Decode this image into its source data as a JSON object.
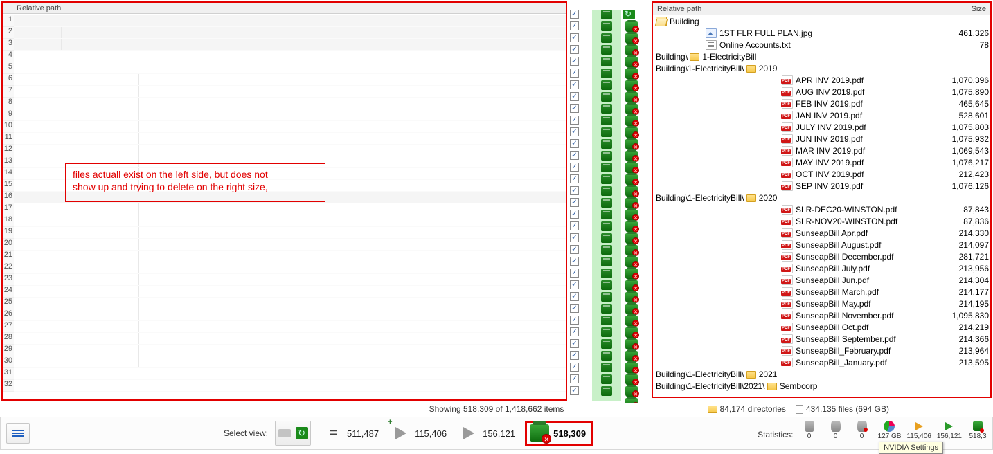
{
  "left": {
    "header": "Relative path",
    "annotation_line1": "files actuall exist on the left side, but does not",
    "annotation_line2": "show up and trying to delete on the right size,",
    "row_numbers": [
      "1",
      "2",
      "3",
      "4",
      "5",
      "6",
      "7",
      "8",
      "9",
      "10",
      "11",
      "12",
      "13",
      "14",
      "15",
      "16",
      "17",
      "18",
      "19",
      "20",
      "21",
      "22",
      "23",
      "24",
      "25",
      "26",
      "27",
      "28",
      "29",
      "30",
      "31",
      "32"
    ]
  },
  "right": {
    "header_path": "Relative path",
    "header_size": "Size",
    "rows": [
      {
        "type": "group",
        "indent": 0,
        "icon": "folder-open",
        "label": "Building",
        "size": ""
      },
      {
        "type": "file",
        "indent": 76,
        "icon": "img",
        "label": "1ST FLR FULL PLAN.jpg",
        "size": "461,326"
      },
      {
        "type": "file",
        "indent": 76,
        "icon": "txt",
        "label": "Online Accounts.txt",
        "size": "78"
      },
      {
        "type": "group-path",
        "indent": 0,
        "label": "Building\\",
        "icon": "folder-open",
        "suffix": "1-ElectricityBill",
        "size": ""
      },
      {
        "type": "group-path",
        "indent": 0,
        "label": "Building\\1-ElectricityBill\\",
        "icon": "folder-open",
        "suffix": "2019",
        "size": ""
      },
      {
        "type": "file",
        "indent": 186,
        "icon": "pdf",
        "label": "APR INV 2019.pdf",
        "size": "1,070,396"
      },
      {
        "type": "file",
        "indent": 186,
        "icon": "pdf",
        "label": "AUG INV 2019.pdf",
        "size": "1,075,890"
      },
      {
        "type": "file",
        "indent": 186,
        "icon": "pdf",
        "label": "FEB INV 2019.pdf",
        "size": "465,645"
      },
      {
        "type": "file",
        "indent": 186,
        "icon": "pdf",
        "label": "JAN INV 2019.pdf",
        "size": "528,601"
      },
      {
        "type": "file",
        "indent": 186,
        "icon": "pdf",
        "label": "JULY INV 2019.pdf",
        "size": "1,075,803"
      },
      {
        "type": "file",
        "indent": 186,
        "icon": "pdf",
        "label": "JUN INV 2019.pdf",
        "size": "1,075,932"
      },
      {
        "type": "file",
        "indent": 186,
        "icon": "pdf",
        "label": "MAR INV 2019.pdf",
        "size": "1,069,543"
      },
      {
        "type": "file",
        "indent": 186,
        "icon": "pdf",
        "label": "MAY INV 2019.pdf",
        "size": "1,076,217"
      },
      {
        "type": "file",
        "indent": 186,
        "icon": "pdf",
        "label": "OCT INV 2019.pdf",
        "size": "212,423"
      },
      {
        "type": "file",
        "indent": 186,
        "icon": "pdf",
        "label": "SEP INV 2019.pdf",
        "size": "1,076,126"
      },
      {
        "type": "group-path",
        "indent": 0,
        "label": "Building\\1-ElectricityBill\\",
        "icon": "folder-open",
        "suffix": "2020",
        "size": ""
      },
      {
        "type": "file",
        "indent": 186,
        "icon": "pdf",
        "label": "SLR-DEC20-WINSTON.pdf",
        "size": "87,843"
      },
      {
        "type": "file",
        "indent": 186,
        "icon": "pdf",
        "label": "SLR-NOV20-WINSTON.pdf",
        "size": "87,836"
      },
      {
        "type": "file",
        "indent": 186,
        "icon": "pdf",
        "label": "SunseapBill Apr.pdf",
        "size": "214,330"
      },
      {
        "type": "file",
        "indent": 186,
        "icon": "pdf",
        "label": "SunseapBill August.pdf",
        "size": "214,097"
      },
      {
        "type": "file",
        "indent": 186,
        "icon": "pdf",
        "label": "SunseapBill December.pdf",
        "size": "281,721"
      },
      {
        "type": "file",
        "indent": 186,
        "icon": "pdf",
        "label": "SunseapBill July.pdf",
        "size": "213,956"
      },
      {
        "type": "file",
        "indent": 186,
        "icon": "pdf",
        "label": "SunseapBill Jun.pdf",
        "size": "214,304"
      },
      {
        "type": "file",
        "indent": 186,
        "icon": "pdf",
        "label": "SunseapBill March.pdf",
        "size": "214,177"
      },
      {
        "type": "file",
        "indent": 186,
        "icon": "pdf",
        "label": "SunseapBill May.pdf",
        "size": "214,195"
      },
      {
        "type": "file",
        "indent": 186,
        "icon": "pdf",
        "label": "SunseapBill November.pdf",
        "size": "1,095,830"
      },
      {
        "type": "file",
        "indent": 186,
        "icon": "pdf",
        "label": "SunseapBill Oct.pdf",
        "size": "214,219"
      },
      {
        "type": "file",
        "indent": 186,
        "icon": "pdf",
        "label": "SunseapBill September.pdf",
        "size": "214,366"
      },
      {
        "type": "file",
        "indent": 186,
        "icon": "pdf",
        "label": "SunseapBill_February.pdf",
        "size": "213,964"
      },
      {
        "type": "file",
        "indent": 186,
        "icon": "pdf",
        "label": "SunseapBill_January.pdf",
        "size": "213,595"
      },
      {
        "type": "group-path",
        "indent": 0,
        "label": "Building\\1-ElectricityBill\\",
        "icon": "folder-open",
        "suffix": "2021",
        "size": ""
      },
      {
        "type": "group-path",
        "indent": 0,
        "label": "Building\\1-ElectricityBill\\2021\\",
        "icon": "folder-open",
        "suffix": "Sembcorp",
        "size": ""
      }
    ]
  },
  "footer": {
    "items_showing": "Showing 518,309 of 1,418,662 items",
    "dirs": "84,174 directories",
    "files": "434,135 files  (694 GB)",
    "select_view": "Select view:",
    "equal_count": "511,487",
    "copy_plus_count": "115,406",
    "copy_count": "156,121",
    "delete_count": "518,309",
    "stats_label": "Statistics:",
    "mini": [
      {
        "label": "0"
      },
      {
        "label": "0"
      },
      {
        "label": "0"
      },
      {
        "label": "127 GB"
      },
      {
        "label": "115,406"
      },
      {
        "label": "156,121"
      },
      {
        "label": "518,3"
      }
    ],
    "tooltip": "NVIDIA Settings"
  },
  "mid": {
    "row_count": 33
  }
}
